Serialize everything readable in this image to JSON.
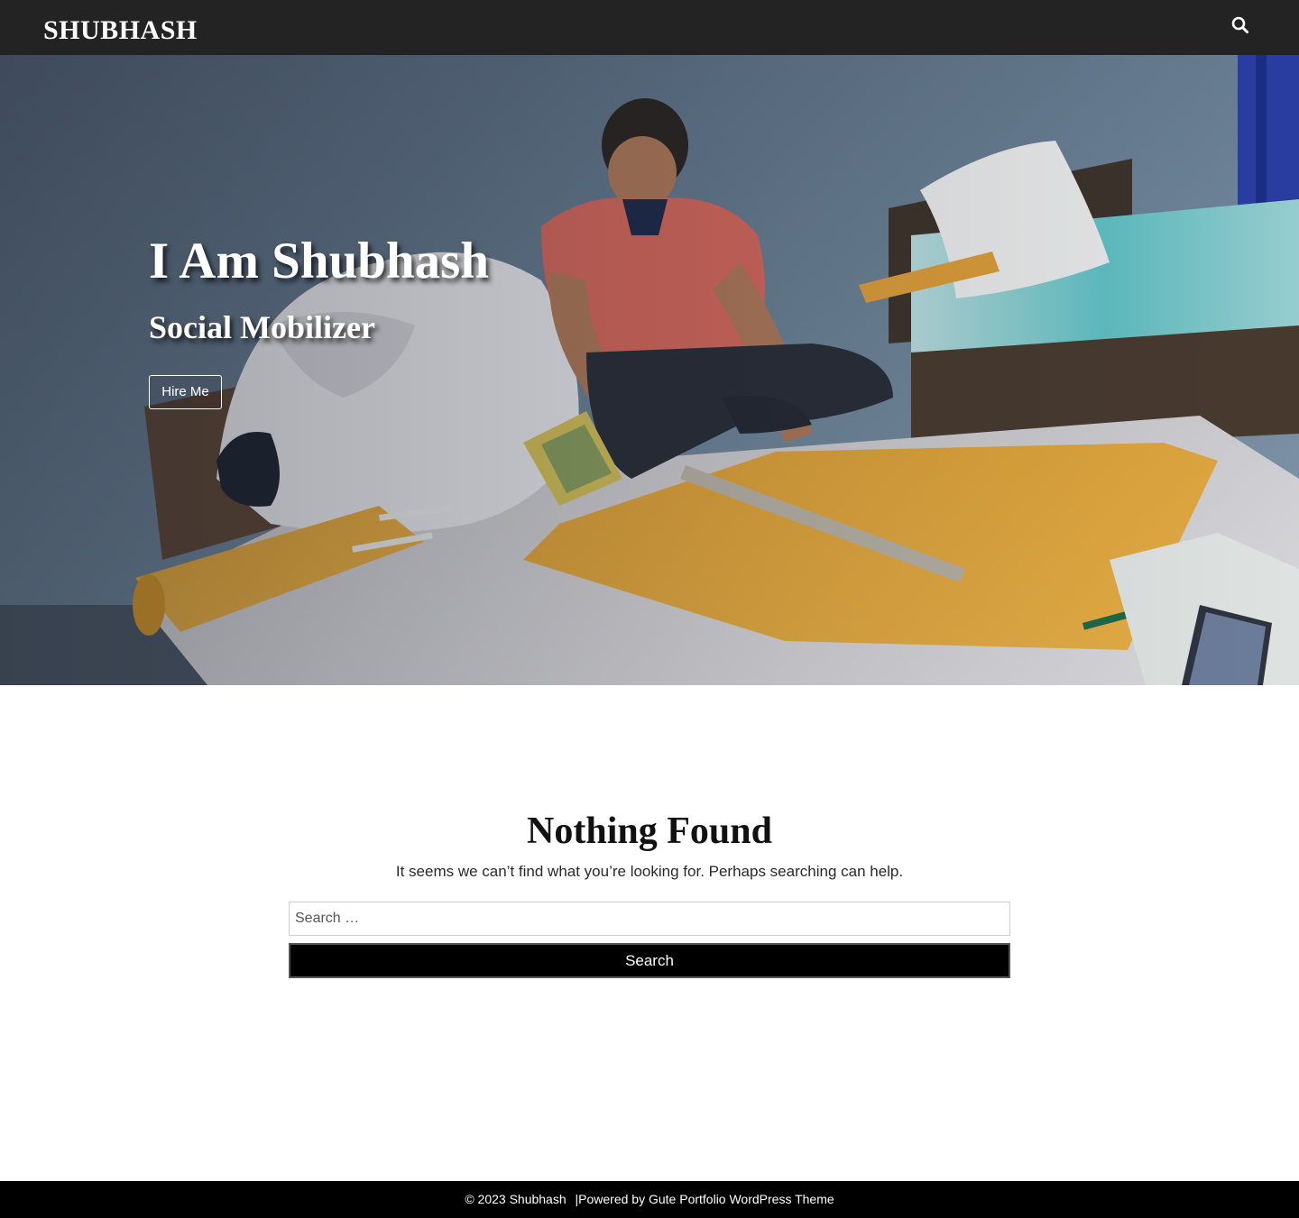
{
  "header": {
    "site_title": "SHUBHASH",
    "search_icon": "search-icon"
  },
  "hero": {
    "title": "I Am Shubhash",
    "subtitle": "Social Mobilizer",
    "button_label": "Hire Me"
  },
  "main": {
    "heading": "Nothing Found",
    "message": "It seems we can’t find what you’re looking for. Perhaps searching can help.",
    "search_placeholder": "Search …",
    "search_value": "",
    "search_button": "Search"
  },
  "footer": {
    "copyright": "© 2023 Shubhash",
    "separator": "|",
    "powered_prefix": "Powered by",
    "theme_link": "Gute Portfolio WordPress Theme"
  },
  "colors": {
    "topbar": "#232323",
    "footer": "#000000",
    "button": "#000000"
  }
}
